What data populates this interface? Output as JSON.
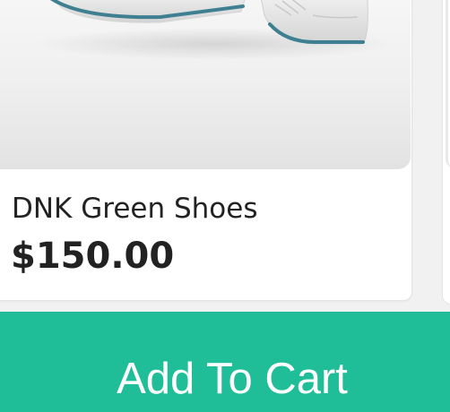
{
  "product": {
    "name": "DNK Green Shoes",
    "price": "$150.00",
    "image_icon": "sneaker-image"
  },
  "cart_button": {
    "label": "Add To Cart"
  },
  "colors": {
    "accent": "#1fbe98",
    "text": "#222222",
    "card_bg": "#ffffff",
    "page_bg": "#f1f1f1",
    "shoe_trim": "#3f7f92"
  }
}
